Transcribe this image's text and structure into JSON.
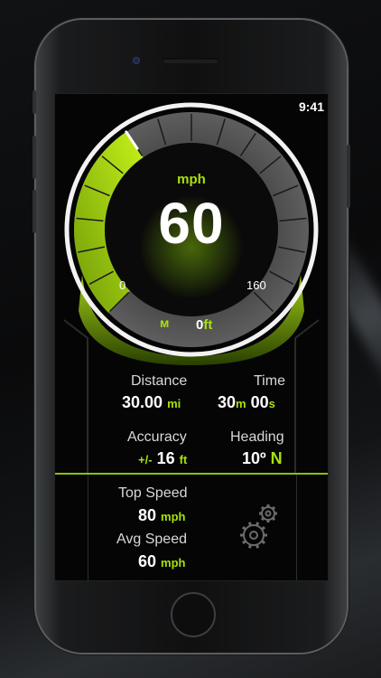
{
  "status_bar": {
    "time": "9:41"
  },
  "speedometer": {
    "speed": "60",
    "unit": "mph",
    "min_label": "0",
    "max_label": "160",
    "max_value": 160,
    "accent_color": "#a8e20a"
  },
  "altitude": {
    "icon": "mountain-icon",
    "value": "0",
    "unit": "ft"
  },
  "distance": {
    "label": "Distance",
    "value": "30.00",
    "unit": "mi"
  },
  "time": {
    "label": "Time",
    "minutes": "30",
    "minutes_unit": "m",
    "seconds": "00",
    "seconds_unit": "s"
  },
  "accuracy": {
    "label": "Accuracy",
    "prefix": "+/-",
    "value": "16",
    "unit": "ft"
  },
  "heading": {
    "label": "Heading",
    "value": "10º",
    "direction": "N"
  },
  "top_speed": {
    "label": "Top Speed",
    "value": "80",
    "unit": "mph"
  },
  "avg_speed": {
    "label": "Avg Speed",
    "value": "60",
    "unit": "mph"
  },
  "settings": {
    "icon": "gears-icon"
  }
}
